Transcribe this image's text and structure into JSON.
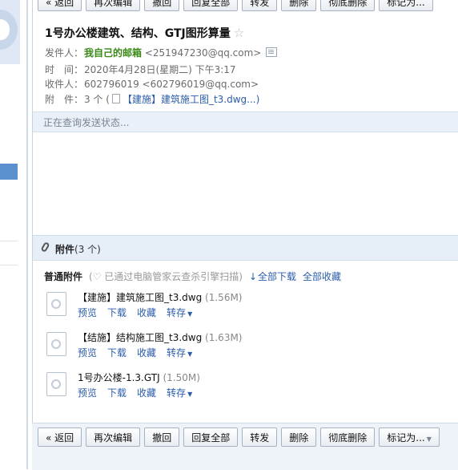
{
  "toolbar": {
    "back": "« 返回",
    "re_edit": "再次编辑",
    "recall": "撤回",
    "reply_all": "回复全部",
    "forward": "转发",
    "delete": "删除",
    "delete_perm": "彻底删除",
    "mark_as": "标记为..."
  },
  "mail": {
    "subject": "1号办公楼建筑、结构、GTJ图形算量",
    "sender_label": "发件人：",
    "sender_name": "我自己的邮箱",
    "sender_email": "<251947230@qq.com>",
    "time_label": "时　间：",
    "time_value": "2020年4月28日(星期二) 下午3:17",
    "to_label": "收件人：",
    "to_value": "602796019 <602796019@qq.com>",
    "att_label": "附　件：",
    "att_count": "3 个 (",
    "att_summary": "【建施】建筑施工图_t3.dwg...)",
    "status": "正在查询发送状态..."
  },
  "attachments": {
    "title": "附件",
    "count": "(3 个)",
    "normal_label": "普通附件",
    "scan_note": "(♡ 已通过电脑管家云查杀引擎扫描)",
    "download_all": "全部下载",
    "save_all": "全部收藏",
    "ops": {
      "preview": "预览",
      "download": "下载",
      "save": "收藏",
      "forward": "转存"
    },
    "files": [
      {
        "name": "【建施】建筑施工图_t3.dwg",
        "size": "(1.56M)"
      },
      {
        "name": "【结施】结构施工图_t3.dwg",
        "size": "(1.63M)"
      },
      {
        "name": "1号办公楼-1.3.GTJ",
        "size": "(1.50M)"
      }
    ]
  }
}
